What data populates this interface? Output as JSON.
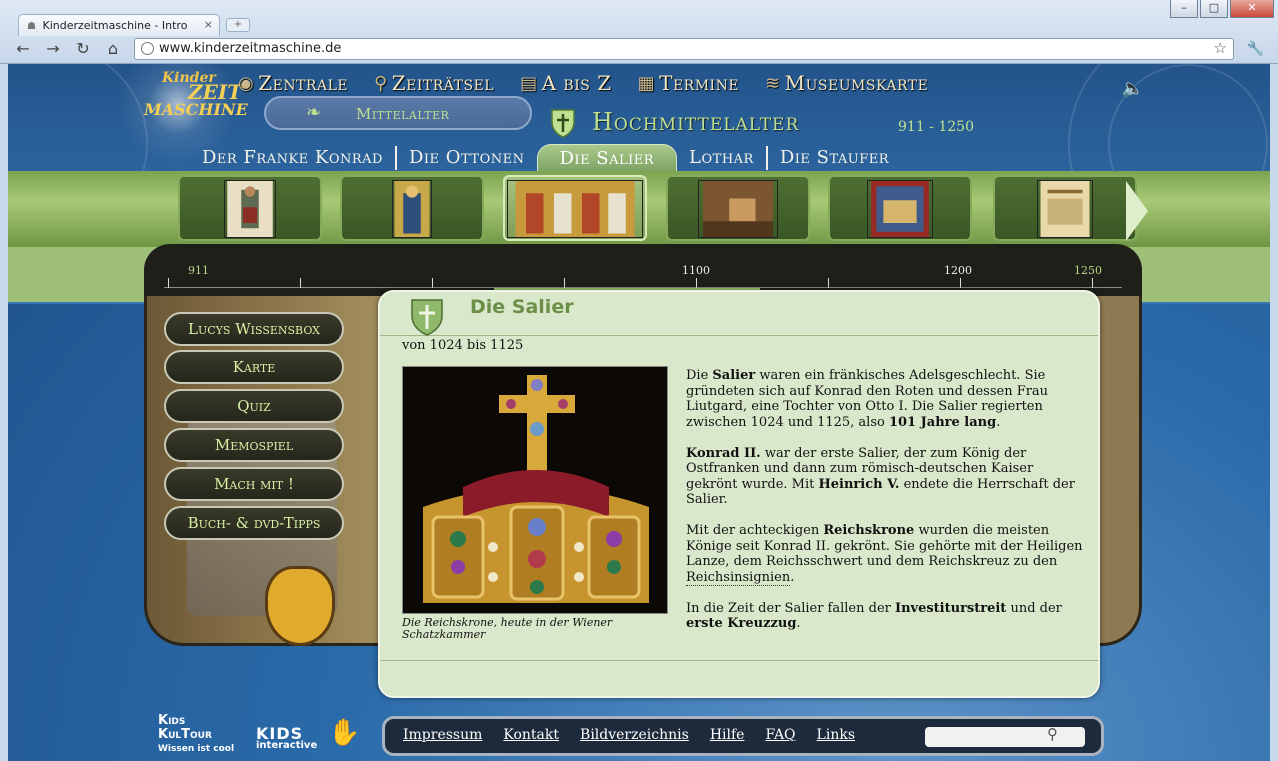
{
  "browser": {
    "tab_title": "Kinderzeitmaschine - Intro",
    "new_tab": "+",
    "url": "www.kinderzeitmaschine.de",
    "buttons": {
      "back": "←",
      "forward": "→",
      "reload": "↻",
      "home": "⌂",
      "star": "☆",
      "wrench": "🔧",
      "tab_close": "×"
    },
    "window": {
      "min": "–",
      "max": "□",
      "close": "✕"
    }
  },
  "logo": {
    "line1": "Kinder",
    "line2": "ZEIT",
    "line3": "MASCHINE"
  },
  "main_nav": [
    {
      "label": "Zentrale",
      "icon": "globe-icon",
      "glyph": "◉"
    },
    {
      "label": "Zeiträtsel",
      "icon": "magnifier-icon",
      "glyph": "⚲"
    },
    {
      "label": "A bis Z",
      "icon": "book-icon",
      "glyph": "▤"
    },
    {
      "label": "Termine",
      "icon": "calendar-icon",
      "glyph": "▦"
    },
    {
      "label": "Museumskarte",
      "icon": "scroll-map-icon",
      "glyph": "≋"
    }
  ],
  "speaker_glyph": "🔈",
  "epoch": {
    "label": "Mittelalter",
    "glyph": "❧"
  },
  "era": {
    "title": "Hochmittelalter",
    "years": "911 - 1250"
  },
  "sub_nav": [
    {
      "label": "Der Franke Konrad",
      "active": false
    },
    {
      "label": "Die Ottonen",
      "active": false
    },
    {
      "label": "Die Salier",
      "active": true
    },
    {
      "label": "Lothar",
      "active": false
    },
    {
      "label": "Die Staufer",
      "active": false
    }
  ],
  "timeline": {
    "start": "911",
    "mid": "1100",
    "later": "1200",
    "end": "1250"
  },
  "side_menu": [
    "Lucys Wissensbox",
    "Karte",
    "Quiz",
    "Memospiel",
    "Mach mit !",
    "Buch- & dvd-Tipps"
  ],
  "content": {
    "title": "Die Salier",
    "range": "von 1024 bis 1125",
    "caption": "Die Reichskrone, heute in der Wiener Schatzkammer",
    "p1_a": "Die ",
    "p1_b": "Salier",
    "p1_c": " waren ein fränkisches Adelsgeschlecht. Sie gründeten sich auf Konrad den Roten und dessen Frau Liutgard, eine Tochter von Otto I. Die Salier regierten zwischen 1024 und 1125, also ",
    "p1_d": "101 Jahre lang",
    "p1_e": ".",
    "p2_a": "Konrad II.",
    "p2_b": " war der erste Salier, der zum König der Ostfranken und dann zum römisch-deutschen Kaiser gekrönt wurde. Mit ",
    "p2_c": "Heinrich V.",
    "p2_d": " endete die Herrschaft der Salier.",
    "p3_a": "Mit der achteckigen ",
    "p3_b": "Reichskrone",
    "p3_c": " wurden die meisten Könige seit Konrad II. gekrönt. Sie gehörte mit der Heiligen Lanze, dem Reichsschwert und dem Reichskreuz zu den ",
    "p3_d": "Reichsinsignien",
    "p3_e": ".",
    "p4_a": "In die Zeit der Salier fallen der ",
    "p4_b": "Investiturstreit",
    "p4_c": " und der ",
    "p4_d": "erste Kreuzzug",
    "p4_e": "."
  },
  "footer": {
    "links": [
      "Impressum",
      "Kontakt",
      "Bildverzeichnis",
      "Hilfe",
      "FAQ",
      "Links"
    ],
    "search_glyph": "⚲"
  },
  "brands": {
    "kids_kultour_1": "Kids",
    "kids_kultour_2": "KulTour",
    "kids_kultour_3": "Wissen ist cool",
    "kids_interactive_1": "KIDS",
    "kids_interactive_2": "interactive",
    "kids_interactive_glyph": "✋"
  },
  "colors": {
    "accent_green": "#bfe090",
    "page_blue": "#2a6aa9",
    "content_bg": "#d9e8cb"
  }
}
